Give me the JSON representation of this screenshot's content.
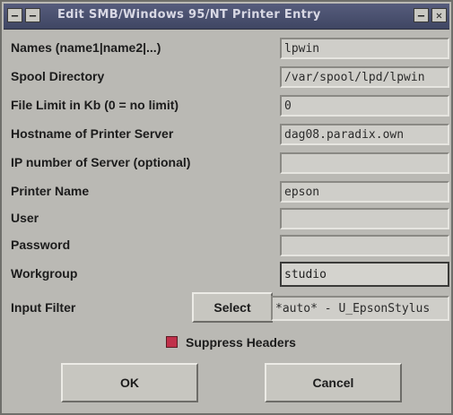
{
  "window": {
    "title": "Edit SMB/Windows 95/NT Printer Entry",
    "menu_glyph": "–",
    "min_glyph": "–",
    "close_glyph": "✕"
  },
  "fields": [
    {
      "label": "Names (name1|name2|...)",
      "value": "lpwin"
    },
    {
      "label": "Spool Directory",
      "value": "/var/spool/lpd/lpwin"
    },
    {
      "label": "File Limit in Kb (0 = no limit)",
      "value": "0"
    },
    {
      "label": "Hostname of Printer Server",
      "value": "dag08.paradix.own"
    },
    {
      "label": "IP number of Server (optional)",
      "value": ""
    },
    {
      "label": "Printer Name",
      "value": "epson"
    },
    {
      "label": "User",
      "value": ""
    },
    {
      "label": "Password",
      "value": ""
    },
    {
      "label": "Workgroup",
      "value": "studio"
    },
    {
      "label": "Input Filter",
      "value": "*auto* - U_EpsonStylus"
    }
  ],
  "select_label": "Select",
  "suppress_headers": {
    "label": "Suppress Headers",
    "checked": true
  },
  "buttons": {
    "ok": "OK",
    "cancel": "Cancel"
  },
  "colors": {
    "titlebar": "#4a5070",
    "checkbox": "#c0304a"
  }
}
